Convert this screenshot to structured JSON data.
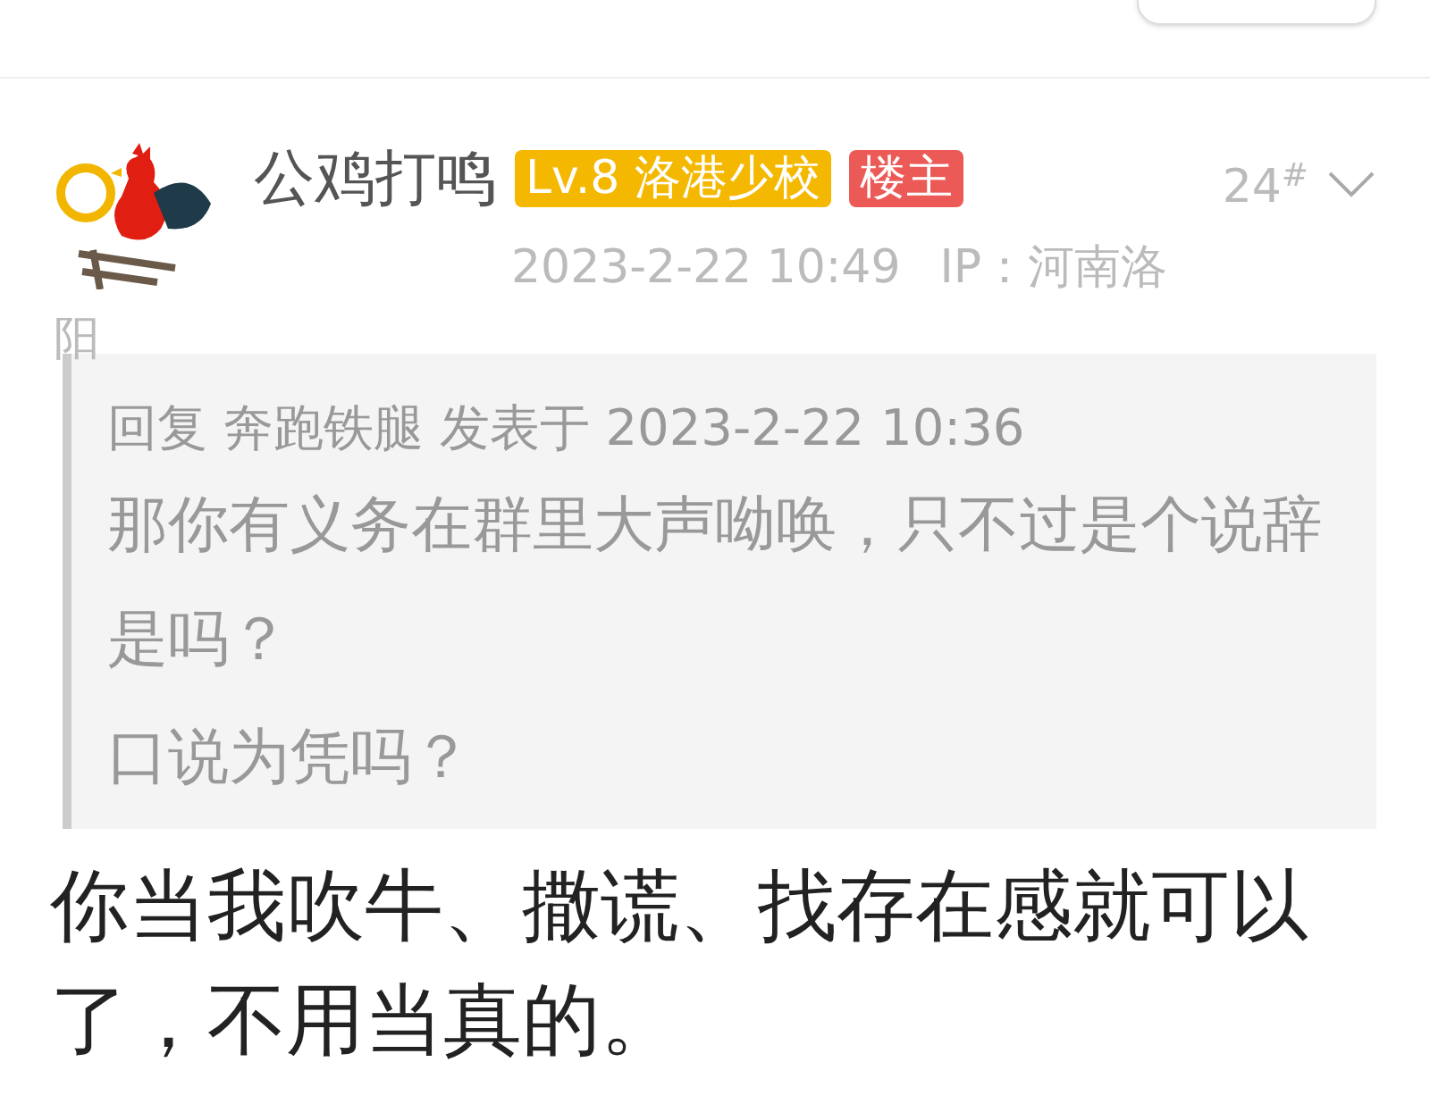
{
  "post": {
    "author": "公鸡打鸣",
    "level_badge": "Lv.8 洛港少校",
    "owner_badge": "楼主",
    "floor": "24",
    "floor_mark": "#",
    "time": "2023-2-22 10:49",
    "ip": "IP：河南洛阳",
    "quote": {
      "header": "回复 奔跑铁腿 发表于 2023-2-22 10:36",
      "lines": [
        "那你有义务在群里大声呦唤，只不过是个说辞是吗？",
        "口说为凭吗？"
      ]
    },
    "body": "你当我吹牛、撒谎、找存在感就可以了，不用当真的。"
  }
}
